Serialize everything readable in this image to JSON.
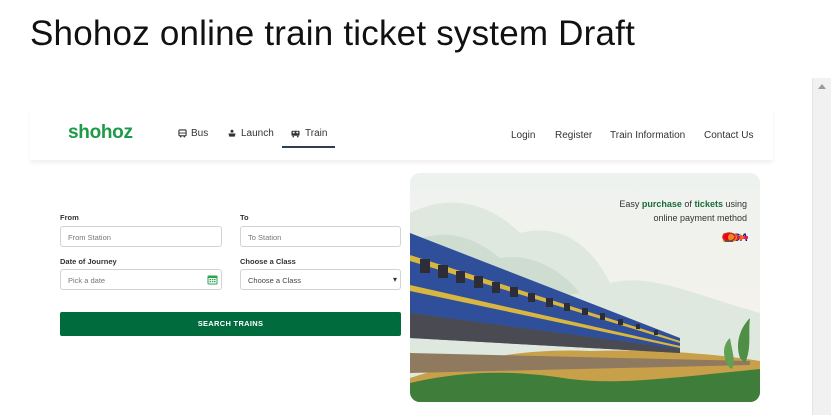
{
  "doc_title": "Shohoz online train ticket system Draft",
  "brand": {
    "logo_text": "shohoz",
    "color": "#1e9a48"
  },
  "nav": {
    "items": [
      {
        "label": "Bus",
        "icon": "bus-icon"
      },
      {
        "label": "Launch",
        "icon": "ship-icon"
      },
      {
        "label": "Train",
        "icon": "train-icon",
        "active": true
      }
    ],
    "links": [
      "Login",
      "Register",
      "Train Information",
      "Contact Us"
    ]
  },
  "form": {
    "from_label": "From",
    "from_placeholder": "From Station",
    "to_label": "To",
    "to_placeholder": "To Station",
    "date_label": "Date of Journey",
    "date_placeholder": "Pick a date",
    "class_label": "Choose a Class",
    "class_selected": "Choose a Class",
    "search_label": "SEARCH TRAINS"
  },
  "hero": {
    "line1_prefix": "Easy ",
    "line1_em1": "purchase",
    "line1_mid": " of ",
    "line1_em2": "tickets",
    "line1_suffix": " using",
    "line2": "online payment method",
    "payments": [
      "bKash",
      "Nagad",
      "Rocket",
      "upay",
      "Mastercard",
      "VISA",
      "DBBL"
    ]
  },
  "colors": {
    "primary_button": "#006b3c",
    "accent": "#1b6b3a"
  }
}
